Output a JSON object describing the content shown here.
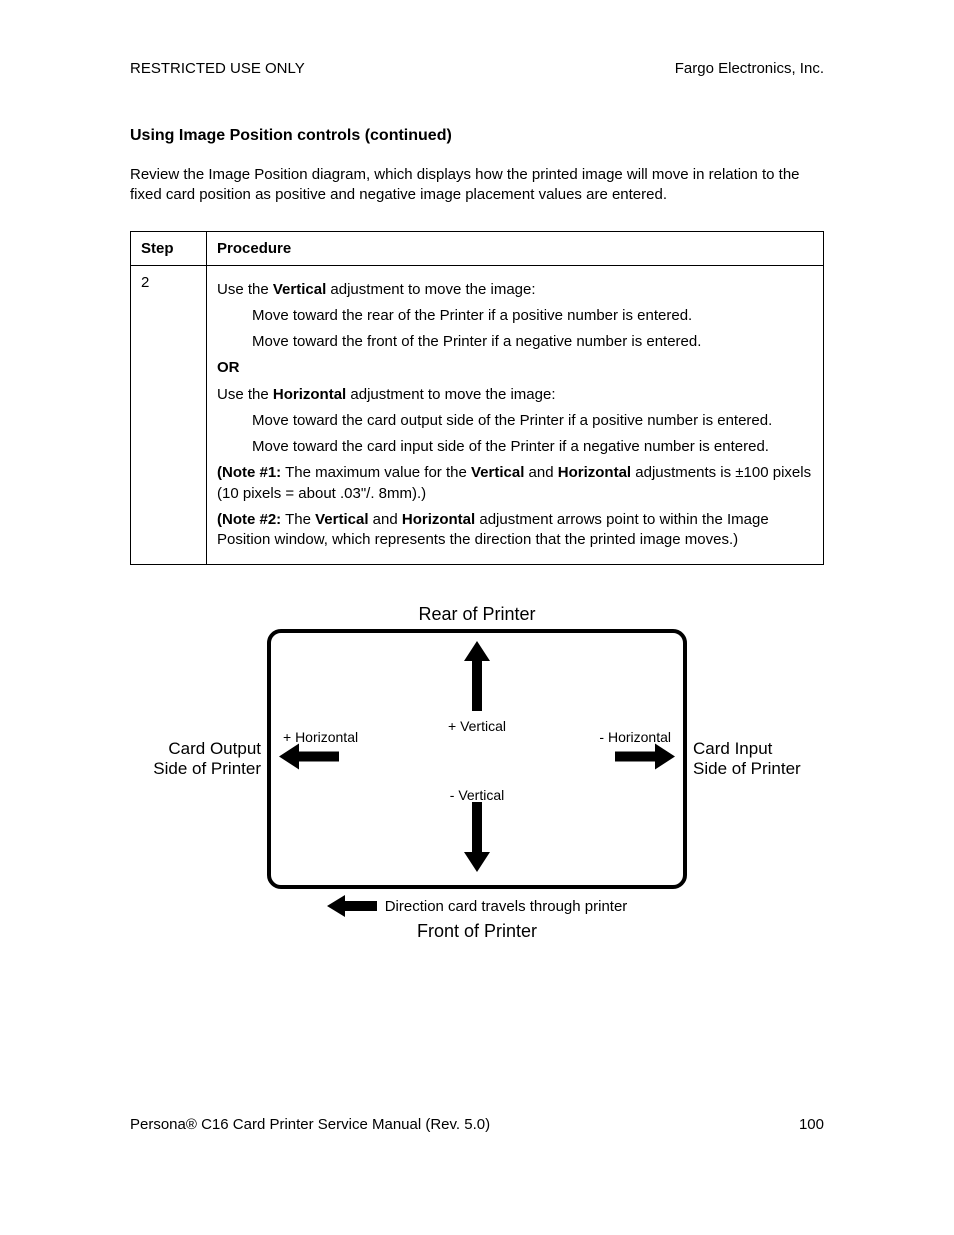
{
  "header": {
    "left": "RESTRICTED USE ONLY",
    "right": "Fargo Electronics, Inc."
  },
  "section_title": "Using Image Position controls (continued)",
  "intro": "Review the Image Position diagram, which displays how the printed image will move in relation to the fixed card position as positive and negative image placement values are entered.",
  "table": {
    "headers": {
      "step": "Step",
      "procedure": "Procedure"
    },
    "step_number": "2",
    "procedure": {
      "line1_pre": "Use the ",
      "line1_bold": "Vertical",
      "line1_post": " adjustment to move the image:",
      "bullet1": "Move toward the rear of the Printer if a positive number is entered.",
      "bullet2": "Move toward the front of the Printer if a negative number is entered.",
      "or": "OR",
      "line2_pre": "Use the ",
      "line2_bold": "Horizontal",
      "line2_post": " adjustment to move the image:",
      "bullet3": "Move toward the card output side of the Printer if a positive number is entered.",
      "bullet4": "Move toward the card input side of the Printer if a negative number is entered.",
      "note1_label": "(Note #1:",
      "note1_a": "  The maximum value for the ",
      "note1_b1": "Vertical",
      "note1_mid": " and ",
      "note1_b2": "Horizontal",
      "note1_c": " adjustments is ±100 pixels (10 pixels = about .03\"/. 8mm).)",
      "note2_label": "(Note #2:",
      "note2_a": "  The ",
      "note2_b1": "Vertical",
      "note2_mid": " and ",
      "note2_b2": "Horizontal",
      "note2_c": " adjustment arrows point to within the Image Position window, which represents the direction that the printed image moves.)"
    }
  },
  "diagram": {
    "top": "Rear of Printer",
    "bottom": "Front of Printer",
    "left_side_l1": "Card Output",
    "left_side_l2": "Side of Printer",
    "right_side_l1": "Card Input",
    "right_side_l2": "Side of Printer",
    "plus_v": "+ Vertical",
    "minus_v": "- Vertical",
    "plus_h": "+ Horizontal",
    "minus_h": "- Horizontal",
    "travel": "Direction card travels through printer"
  },
  "footer": {
    "left": "Persona® C16 Card Printer Service Manual (Rev. 5.0)",
    "right": "100"
  }
}
